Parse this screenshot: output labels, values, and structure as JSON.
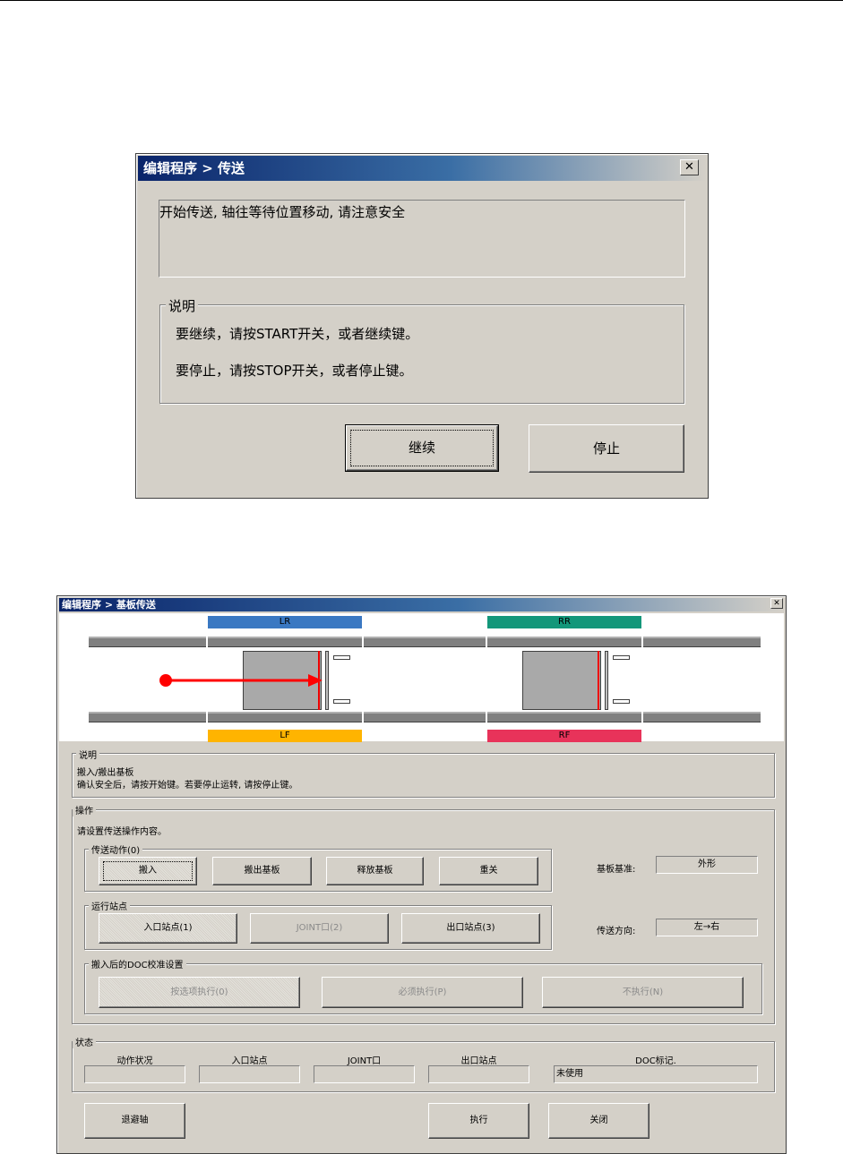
{
  "dialog1": {
    "title": "编辑程序 > 传送",
    "message": "开始传送, 轴往等待位置移动,  请注意安全",
    "group_label": "说明",
    "line1": "要继续，请按START开关，或者继续键。",
    "line2": "要停止，请按STOP开关，或者停止键。",
    "continue_label": "继续",
    "stop_label": "停止",
    "close_glyph": "✕"
  },
  "dialog2": {
    "title": "编辑程序 > 基板传送",
    "close_glyph": "✕",
    "stations": {
      "lr": {
        "label": "LR",
        "color": "#3a78c2"
      },
      "rr": {
        "label": "RR",
        "color": "#13977a"
      },
      "lf": {
        "label": "LF",
        "color": "#ffb400"
      },
      "rf": {
        "label": "RF",
        "color": "#e8335a"
      }
    },
    "arrow_color": "#ff0000",
    "explain": {
      "label": "说明",
      "line1": "搬入/搬出基板",
      "line2": "确认安全后，请按开始键。若要停止运转, 请按停止键。"
    },
    "operation": {
      "label": "操作",
      "prompt": "请设置传送操作内容。",
      "action_group": "传送动作(0)",
      "actions": [
        "搬入",
        "搬出基板",
        "释放基板",
        "重关"
      ],
      "station_group": "运行站点",
      "stations": [
        "入口站点(1)",
        "JOINT口(2)",
        "出口站点(3)"
      ],
      "doc_group": "搬入后的DOC校准设置",
      "doc_options": [
        "按选项执行(0)",
        "必须执行(P)",
        "不执行(N)"
      ],
      "board_ref_label": "基板基准:",
      "board_ref_value": "外形",
      "direction_label": "传送方向:",
      "direction_value": "左→右"
    },
    "status": {
      "label": "状态",
      "cols": [
        "动作状况",
        "入口站点",
        "JOINT口",
        "出口站点",
        "DOC标记."
      ],
      "values": [
        "",
        "",
        "",
        "",
        "未使用"
      ]
    },
    "buttons": {
      "retreat": "退避轴",
      "execute": "执行",
      "close": "关闭"
    }
  }
}
